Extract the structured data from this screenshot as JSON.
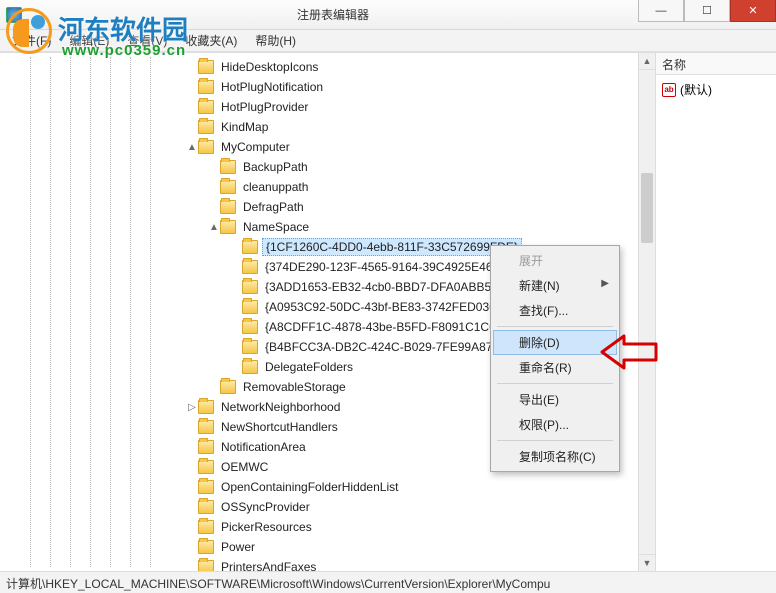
{
  "window": {
    "title": "注册表编辑器",
    "min_glyph": "—",
    "max_glyph": "☐",
    "close_glyph": "✕"
  },
  "watermark": {
    "brand": "河东软件园",
    "url": "www.pc0359.cn"
  },
  "menubar": {
    "file": "文件(F)",
    "edit": "编辑(E)",
    "view": "查看(V)",
    "fav": "收藏夹(A)",
    "help": "帮助(H)"
  },
  "tree": {
    "indent_base": 120,
    "items": [
      {
        "level": 3,
        "expand": "",
        "label": "HideDesktopIcons"
      },
      {
        "level": 3,
        "expand": "",
        "label": "HotPlugNotification"
      },
      {
        "level": 3,
        "expand": "",
        "label": "HotPlugProvider"
      },
      {
        "level": 3,
        "expand": "",
        "label": "KindMap"
      },
      {
        "level": 3,
        "expand": "▲",
        "label": "MyComputer"
      },
      {
        "level": 4,
        "expand": "",
        "label": "BackupPath"
      },
      {
        "level": 4,
        "expand": "",
        "label": "cleanuppath"
      },
      {
        "level": 4,
        "expand": "",
        "label": "DefragPath"
      },
      {
        "level": 4,
        "expand": "▲",
        "label": "NameSpace"
      },
      {
        "level": 5,
        "expand": "",
        "label": "{1CF1260C-4DD0-4ebb-811F-33C572699FDE}",
        "selected": true
      },
      {
        "level": 5,
        "expand": "",
        "label": "{374DE290-123F-4565-9164-39C4925E467B}"
      },
      {
        "level": 5,
        "expand": "",
        "label": "{3ADD1653-EB32-4cb0-BBD7-DFA0ABB5ACC"
      },
      {
        "level": 5,
        "expand": "",
        "label": "{A0953C92-50DC-43bf-BE83-3742FED03C9C"
      },
      {
        "level": 5,
        "expand": "",
        "label": "{A8CDFF1C-4878-43be-B5FD-F8091C1C60D0"
      },
      {
        "level": 5,
        "expand": "",
        "label": "{B4BFCC3A-DB2C-424C-B029-7FE99A87C641"
      },
      {
        "level": 5,
        "expand": "",
        "label": "DelegateFolders"
      },
      {
        "level": 4,
        "expand": "",
        "label": "RemovableStorage"
      },
      {
        "level": 3,
        "expand": "▷",
        "label": "NetworkNeighborhood"
      },
      {
        "level": 3,
        "expand": "",
        "label": "NewShortcutHandlers"
      },
      {
        "level": 3,
        "expand": "",
        "label": "NotificationArea"
      },
      {
        "level": 3,
        "expand": "",
        "label": "OEMWC"
      },
      {
        "level": 3,
        "expand": "",
        "label": "OpenContainingFolderHiddenList"
      },
      {
        "level": 3,
        "expand": "",
        "label": "OSSyncProvider"
      },
      {
        "level": 3,
        "expand": "",
        "label": "PickerResources"
      },
      {
        "level": 3,
        "expand": "",
        "label": "Power"
      },
      {
        "level": 3,
        "expand": "",
        "label": "PrintersAndFaxes"
      }
    ]
  },
  "contextmenu": {
    "expand": "展开",
    "new": "新建(N)",
    "find": "查找(F)...",
    "delete": "删除(D)",
    "rename": "重命名(R)",
    "export": "导出(E)",
    "perm": "权限(P)...",
    "copyname": "复制项名称(C)",
    "sub_arrow": "▶"
  },
  "rightpane": {
    "header": "名称",
    "default_label": "(默认)",
    "value_glyph": "ab"
  },
  "statusbar": {
    "path": "计算机\\HKEY_LOCAL_MACHINE\\SOFTWARE\\Microsoft\\Windows\\CurrentVersion\\Explorer\\MyCompu"
  }
}
